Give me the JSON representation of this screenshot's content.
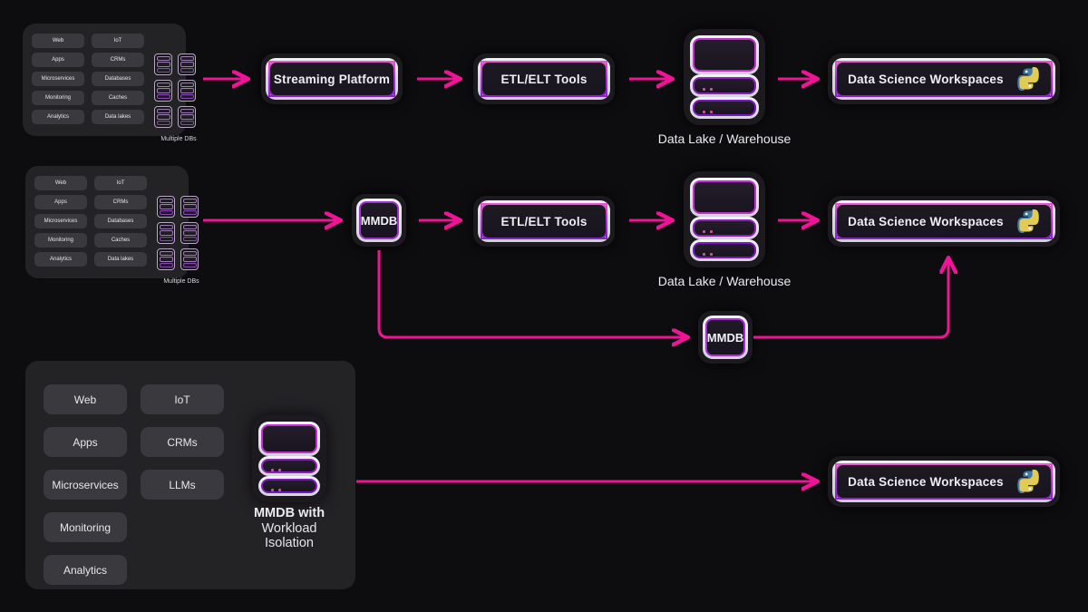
{
  "theme": {
    "background": "#0d0d0f",
    "accent_pink": "#ef1496",
    "accent_purple": "#a52fd4",
    "panel_bg": "#232326",
    "chip_bg": "#3a3a3e",
    "text": "#efeff3"
  },
  "rows": [
    {
      "id": "row-legacy-streaming",
      "source_panel": {
        "chips_left": [
          "Web",
          "Apps",
          "Microservices",
          "Monitoring",
          "Analytics"
        ],
        "chips_right": [
          "IoT",
          "CRMs",
          "Databases",
          "Caches",
          "Data lakes"
        ],
        "db_caption": "Multiple DBs",
        "db_count": 6
      },
      "nodes": [
        {
          "id": "streaming-platform",
          "label": "Streaming Platform",
          "type": "pill"
        },
        {
          "id": "etl-elt-tools-1",
          "label": "ETL/ELT Tools",
          "type": "pill"
        },
        {
          "id": "data-lake-warehouse-1",
          "label": "Data Lake / Warehouse",
          "type": "db-stack"
        },
        {
          "id": "data-science-workspaces-1",
          "label": "Data Science Workspaces",
          "type": "pill",
          "icon": "python-icon"
        }
      ]
    },
    {
      "id": "row-mmdb-hybrid",
      "source_panel": {
        "chips_left": [
          "Web",
          "Apps",
          "Microservices",
          "Monitoring",
          "Analytics"
        ],
        "chips_right": [
          "IoT",
          "CRMs",
          "Databases",
          "Caches",
          "Data lakes"
        ],
        "db_caption": "Multiple DBs",
        "db_count": 6
      },
      "nodes": [
        {
          "id": "mmdb-primary",
          "label": "MMDB",
          "type": "mmdb"
        },
        {
          "id": "etl-elt-tools-2",
          "label": "ETL/ELT Tools",
          "type": "pill"
        },
        {
          "id": "data-lake-warehouse-2",
          "label": "Data Lake / Warehouse",
          "type": "db-stack"
        },
        {
          "id": "data-science-workspaces-2",
          "label": "Data Science Workspaces",
          "type": "pill",
          "icon": "python-icon"
        },
        {
          "id": "mmdb-bypass",
          "label": "MMDB",
          "type": "mmdb"
        }
      ]
    },
    {
      "id": "row-mmdb-workload-isolation",
      "source_panel": {
        "chips_left": [
          "Web",
          "Apps",
          "Microservices",
          "Monitoring",
          "Analytics"
        ],
        "chips_right": [
          "IoT",
          "CRMs",
          "LLMs"
        ],
        "stack_caption_line1": "MMDB with",
        "stack_caption_line2": "Workload",
        "stack_caption_line3": "Isolation"
      },
      "nodes": [
        {
          "id": "data-science-workspaces-3",
          "label": "Data Science Workspaces",
          "type": "pill",
          "icon": "python-icon"
        }
      ]
    }
  ]
}
